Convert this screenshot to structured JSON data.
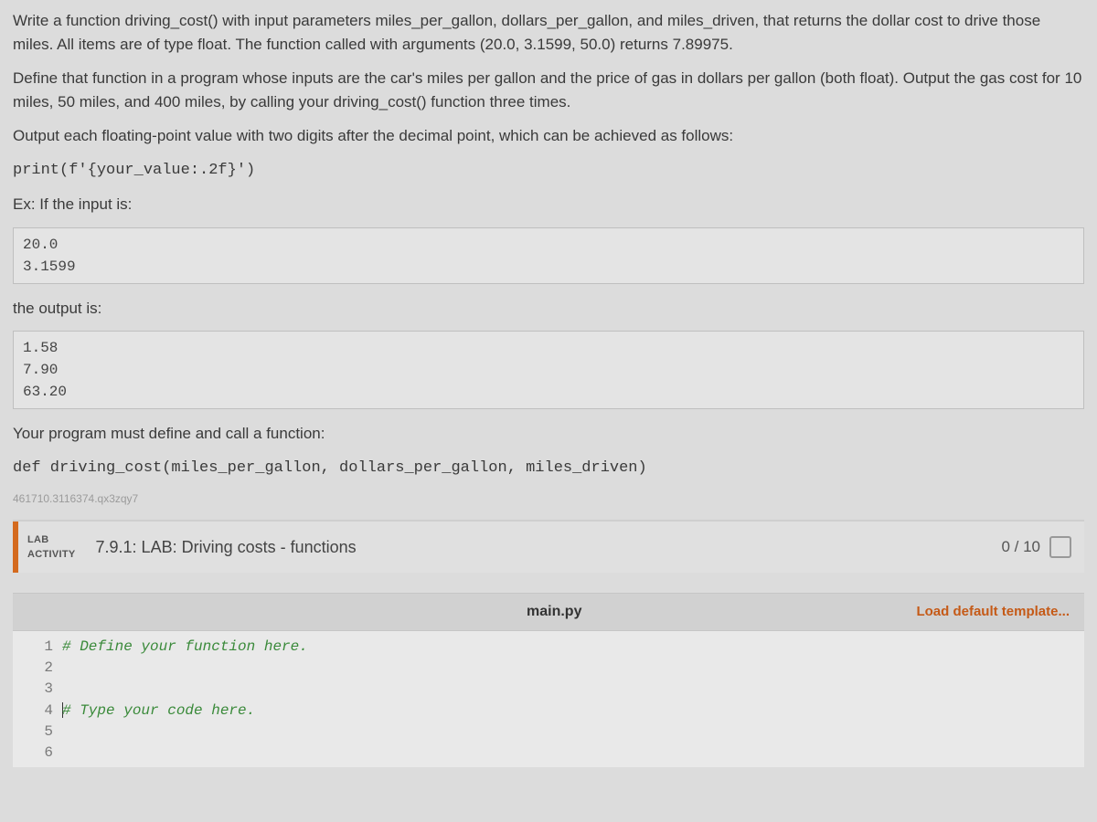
{
  "prompt": {
    "p1": "Write a function driving_cost() with input parameters miles_per_gallon, dollars_per_gallon, and miles_driven, that returns the dollar cost to drive those miles. All items are of type float. The function called with arguments (20.0, 3.1599, 50.0) returns 7.89975.",
    "p2": "Define that function in a program whose inputs are the car's miles per gallon and the price of gas in dollars per gallon (both float). Output the gas cost for 10 miles, 50 miles, and 400 miles, by calling your driving_cost() function three times.",
    "p3": "Output each floating-point value with two digits after the decimal point, which can be achieved as follows:",
    "print_example": "print(f'{your_value:.2f}')",
    "p4": "Ex: If the input is:",
    "input_example": "20.0\n3.1599",
    "p5": "the output is:",
    "output_example": "1.58\n7.90\n63.20",
    "p6a": "Your program must define and call a function:",
    "p6b": "def driving_cost(miles_per_gallon, dollars_per_gallon, miles_driven)"
  },
  "meta_id": "461710.3116374.qx3zqy7",
  "lab": {
    "tag_line1": "LAB",
    "tag_line2": "ACTIVITY",
    "title": "7.9.1: LAB: Driving costs - functions",
    "score": "0 / 10"
  },
  "editor": {
    "filename": "main.py",
    "load_template": "Load default template...",
    "lines": [
      {
        "n": "1",
        "text": "# Define your function here.",
        "comment": true
      },
      {
        "n": "2",
        "text": "",
        "comment": false
      },
      {
        "n": "3",
        "text": "",
        "comment": false
      },
      {
        "n": "4",
        "text": "# Type your code here.",
        "comment": true,
        "cursor": true
      },
      {
        "n": "5",
        "text": "",
        "comment": false
      },
      {
        "n": "6",
        "text": "",
        "comment": false
      }
    ]
  }
}
